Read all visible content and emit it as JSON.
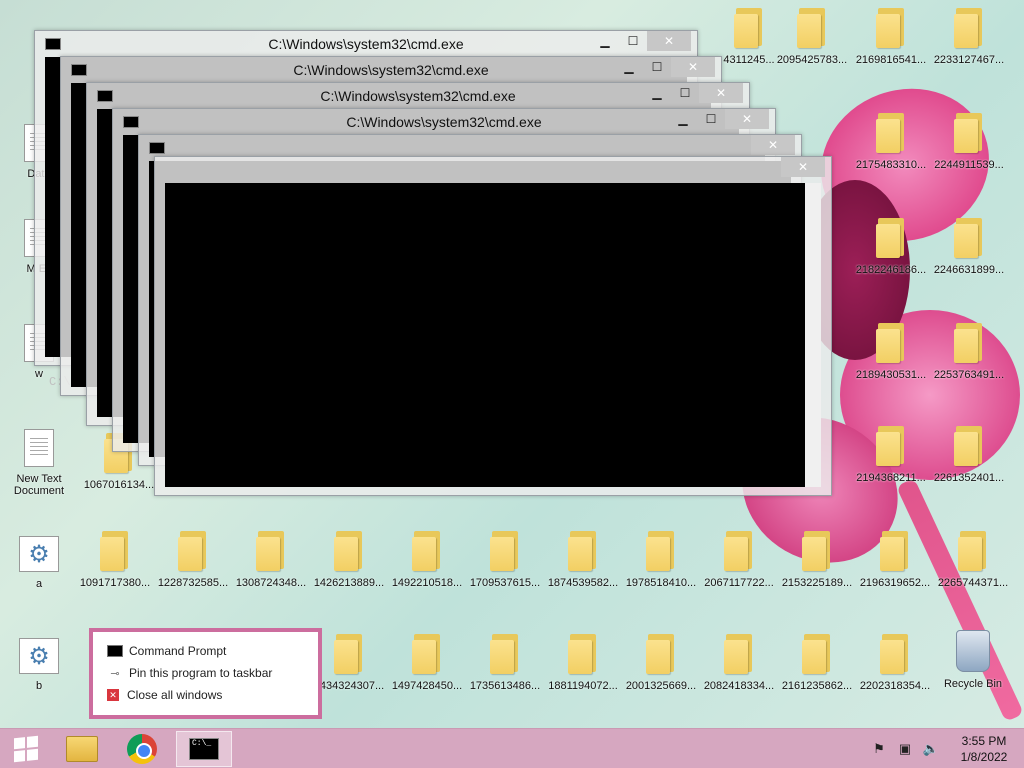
{
  "window_title": "C:\\Windows\\system32\\cmd.exe",
  "prompt_fragment": "C:\\Us",
  "desktop_icons": [
    {
      "label": "1067016134..."
    },
    {
      "label": "New Text Document"
    },
    {
      "label": "a"
    },
    {
      "label": "b"
    },
    {
      "label": "Recycle Bin"
    },
    {
      "label": "Date"
    },
    {
      "label": "M Ex"
    },
    {
      "label": "w"
    },
    {
      "label": "2095425783..."
    },
    {
      "label": "2169816541..."
    },
    {
      "label": "2233127467..."
    },
    {
      "label": "4311245..."
    },
    {
      "label": "2175483310..."
    },
    {
      "label": "2244911539..."
    },
    {
      "label": "2182246186..."
    },
    {
      "label": "2246631899..."
    },
    {
      "label": "2189430531..."
    },
    {
      "label": "2253763491..."
    },
    {
      "label": "2194368211..."
    },
    {
      "label": "2261352401..."
    },
    {
      "label": "1091717380..."
    },
    {
      "label": "1228732585..."
    },
    {
      "label": "1308724348..."
    },
    {
      "label": "1426213889..."
    },
    {
      "label": "1492210518..."
    },
    {
      "label": "1709537615..."
    },
    {
      "label": "1874539582..."
    },
    {
      "label": "1978518410..."
    },
    {
      "label": "2067117722..."
    },
    {
      "label": "2153225189..."
    },
    {
      "label": "2196319652..."
    },
    {
      "label": "2265744371..."
    },
    {
      "label": "1434324307..."
    },
    {
      "label": "1497428450..."
    },
    {
      "label": "1735613486..."
    },
    {
      "label": "1881194072..."
    },
    {
      "label": "2001325669..."
    },
    {
      "label": "2082418334..."
    },
    {
      "label": "2161235862..."
    },
    {
      "label": "2202318354..."
    }
  ],
  "jump_list": {
    "items": [
      "Command Prompt",
      "Pin this program to taskbar",
      "Close all windows"
    ]
  },
  "taskbar": {
    "time": "3:55 PM",
    "date": "1/8/2022"
  }
}
